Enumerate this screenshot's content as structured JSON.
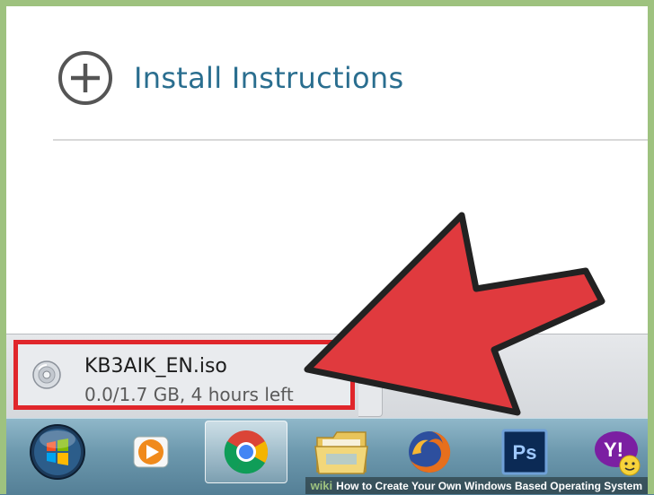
{
  "page": {
    "install_label": "Install Instructions"
  },
  "download": {
    "file_name": "KB3AIK_EN.iso",
    "status": "0.0/1.7 GB, 4 hours left",
    "progress": 0.0
  },
  "taskbar": {
    "items": [
      {
        "name": "start-orb-icon"
      },
      {
        "name": "media-player-icon"
      },
      {
        "name": "chrome-icon",
        "active": true
      },
      {
        "name": "file-explorer-icon"
      },
      {
        "name": "firefox-icon"
      },
      {
        "name": "photoshop-icon",
        "label": "Ps"
      },
      {
        "name": "yahoo-messenger-icon",
        "label": "Y!"
      }
    ]
  },
  "caption": {
    "brand": "wiki",
    "text": "How to Create Your Own Windows Based Operating System"
  },
  "colors": {
    "frame": "#9ec27f",
    "link": "#2a6e8f",
    "highlight": "#e0262b",
    "arrow": "#e03a3e"
  }
}
